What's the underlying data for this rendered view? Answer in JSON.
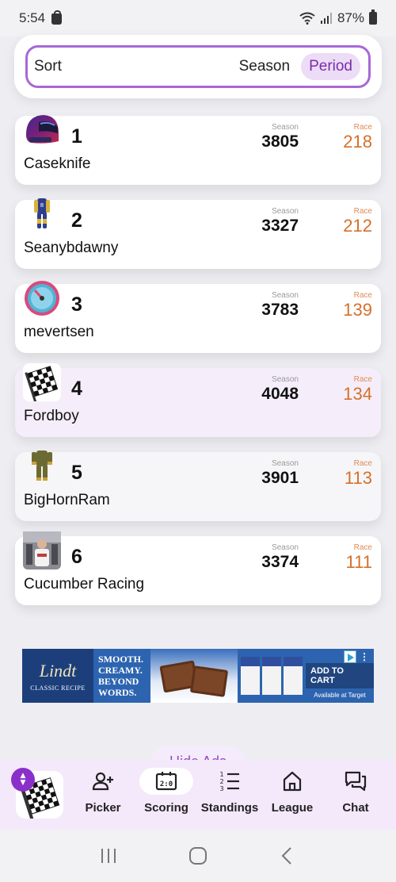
{
  "status_bar": {
    "time": "5:54",
    "battery": "87%",
    "icons": [
      "shopping-bag-icon",
      "wifi-icon",
      "signal-icon",
      "battery-icon"
    ]
  },
  "sort": {
    "label": "Sort",
    "options": [
      "Season",
      "Period"
    ],
    "selected": "Period"
  },
  "column_labels": {
    "season": "Season",
    "race": "Race"
  },
  "standings": [
    {
      "rank": "1",
      "name": "Caseknife",
      "season": "3805",
      "race": "218",
      "avatar": "helmet-icon"
    },
    {
      "rank": "2",
      "name": "Seanybdawny",
      "season": "3327",
      "race": "212",
      "avatar": "driver-suit-icon"
    },
    {
      "rank": "3",
      "name": "mevertsen",
      "season": "3783",
      "race": "139",
      "avatar": "gauge-icon"
    },
    {
      "rank": "4",
      "name": "Fordboy",
      "season": "4048",
      "race": "134",
      "avatar": "checkered-flag-icon"
    },
    {
      "rank": "5",
      "name": "BigHornRam",
      "season": "3901",
      "race": "113",
      "avatar": "firesuit-icon"
    },
    {
      "rank": "6",
      "name": "Cucumber Racing",
      "season": "3374",
      "race": "111",
      "avatar": "photo-avatar"
    }
  ],
  "ad": {
    "brand": "Lindt",
    "brand_sub": "CLASSIC RECIPE",
    "copy_lines": [
      "SMOOTH.",
      "CREAMY.",
      "BEYOND",
      "WORDS."
    ],
    "cta": "ADD TO CART",
    "cta_sub": "Available at Target"
  },
  "hide_ads_label": "Hide Ads",
  "bottom_nav": {
    "items": [
      {
        "label": "Picker",
        "icon": "add-user-icon"
      },
      {
        "label": "Scoring",
        "icon": "scoreboard-icon"
      },
      {
        "label": "Standings",
        "icon": "numbered-list-icon"
      },
      {
        "label": "League",
        "icon": "home-icon"
      },
      {
        "label": "Chat",
        "icon": "chat-icon"
      }
    ],
    "active": "Scoring"
  },
  "colors": {
    "accent": "#a868d8",
    "race_value": "#d6702a",
    "highlight_row": "#f5eefa",
    "nav_bg": "#f4e8fb"
  }
}
